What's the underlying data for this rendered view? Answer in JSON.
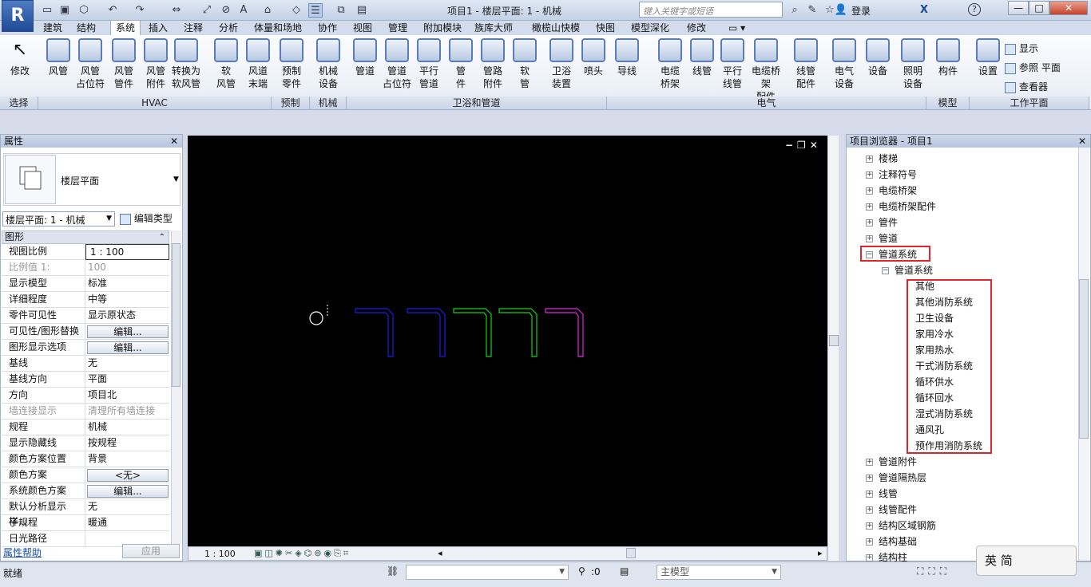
{
  "app": {
    "logo": "R",
    "title": "项目1 - 楼层平面: 1 - 机械",
    "search_placeholder": "键入关键字或短语",
    "login": "登录",
    "help": "?",
    "win_min": "—",
    "win_max": "□",
    "win_close": "✕"
  },
  "tabs": [
    "建筑",
    "结构",
    "系统",
    "插入",
    "注释",
    "分析",
    "体量和场地",
    "协作",
    "视图",
    "管理",
    "附加模块",
    "族库大师",
    "橄榄山快模",
    "快图",
    "模型深化",
    "修改"
  ],
  "active_tab": "系统",
  "ribbon": {
    "modify": "修改",
    "buttons": [
      {
        "l1": "风管",
        "l2": ""
      },
      {
        "l1": "风管",
        "l2": "占位符"
      },
      {
        "l1": "风管",
        "l2": "管件"
      },
      {
        "l1": "风管",
        "l2": "附件"
      },
      {
        "l1": "转换为",
        "l2": "软风管"
      },
      {
        "l1": "软",
        "l2": "风管"
      },
      {
        "l1": "风道",
        "l2": "末端"
      },
      {
        "l1": "预制",
        "l2": "零件"
      },
      {
        "l1": "机械",
        "l2": "设备"
      },
      {
        "l1": "管道",
        "l2": ""
      },
      {
        "l1": "管道",
        "l2": "占位符"
      },
      {
        "l1": "平行",
        "l2": "管道"
      },
      {
        "l1": "管",
        "l2": "件"
      },
      {
        "l1": "管路",
        "l2": "附件"
      },
      {
        "l1": "软",
        "l2": "管"
      },
      {
        "l1": "卫浴",
        "l2": "装置"
      },
      {
        "l1": "喷头",
        "l2": ""
      },
      {
        "l1": "导线",
        "l2": ""
      },
      {
        "l1": "电缆",
        "l2": "桥架"
      },
      {
        "l1": "线管",
        "l2": ""
      },
      {
        "l1": "平行",
        "l2": "线管"
      },
      {
        "l1": "电缆桥架",
        "l2": "配件"
      },
      {
        "l1": "线管",
        "l2": "配件"
      },
      {
        "l1": "电气",
        "l2": "设备"
      },
      {
        "l1": "设备",
        "l2": ""
      },
      {
        "l1": "照明",
        "l2": "设备"
      },
      {
        "l1": "构件",
        "l2": ""
      },
      {
        "l1": "设置",
        "l2": ""
      }
    ],
    "small": [
      "显示",
      "参照 平面",
      "查看器"
    ],
    "panels": [
      "选择",
      "HVAC",
      "预制",
      "机械",
      "卫浴和管道",
      "电气",
      "模型",
      "工作平面"
    ]
  },
  "properties": {
    "title": "属性",
    "type_name": "楼层平面",
    "view_selector": "楼层平面: 1 - 机械",
    "edit_type": "编辑类型",
    "group": "图形",
    "rows": [
      {
        "k": "视图比例",
        "v": "1 : 100"
      },
      {
        "k": "比例值 1:",
        "v": "100"
      },
      {
        "k": "显示模型",
        "v": "标准"
      },
      {
        "k": "详细程度",
        "v": "中等"
      },
      {
        "k": "零件可见性",
        "v": "显示原状态"
      },
      {
        "k": "可见性/图形替换",
        "v": "编辑..."
      },
      {
        "k": "图形显示选项",
        "v": "编辑..."
      },
      {
        "k": "基线",
        "v": "无"
      },
      {
        "k": "基线方向",
        "v": "平面"
      },
      {
        "k": "方向",
        "v": "项目北"
      },
      {
        "k": "墙连接显示",
        "v": "清理所有墙连接"
      },
      {
        "k": "规程",
        "v": "机械"
      },
      {
        "k": "显示隐藏线",
        "v": "按规程"
      },
      {
        "k": "颜色方案位置",
        "v": "背景"
      },
      {
        "k": "颜色方案",
        "v": "<无>"
      },
      {
        "k": "系统颜色方案",
        "v": "编辑..."
      },
      {
        "k": "默认分析显示样...",
        "v": "无"
      },
      {
        "k": "子规程",
        "v": "暖通"
      },
      {
        "k": "日光路径",
        "v": ""
      }
    ],
    "help": "属性帮助",
    "apply": "应用"
  },
  "viewport": {
    "scale": "1 : 100",
    "pipes": [
      {
        "color": "#1f1fe0"
      },
      {
        "color": "#1f1fe0"
      },
      {
        "color": "#18d018"
      },
      {
        "color": "#18d018"
      },
      {
        "color": "#e02ae0"
      }
    ]
  },
  "browser": {
    "title": "项目浏览器 - 项目1",
    "top_items": [
      "楼梯",
      "注释符号",
      "电缆桥架",
      "电缆桥架配件",
      "管件",
      "管道"
    ],
    "expanded": "管道系统",
    "sub": "管道系统",
    "systems": [
      "其他",
      "其他消防系统",
      "卫生设备",
      "家用冷水",
      "家用热水",
      "干式消防系统",
      "循环供水",
      "循环回水",
      "湿式消防系统",
      "通风孔",
      "预作用消防系统"
    ],
    "after_items": [
      "管道附件",
      "管道隔热层",
      "线管",
      "线管配件",
      "结构区域钢筋",
      "结构基础",
      "结构柱"
    ]
  },
  "status": {
    "text": "就绪",
    "count": ":0",
    "model": "主模型"
  },
  "ime": "英 简"
}
